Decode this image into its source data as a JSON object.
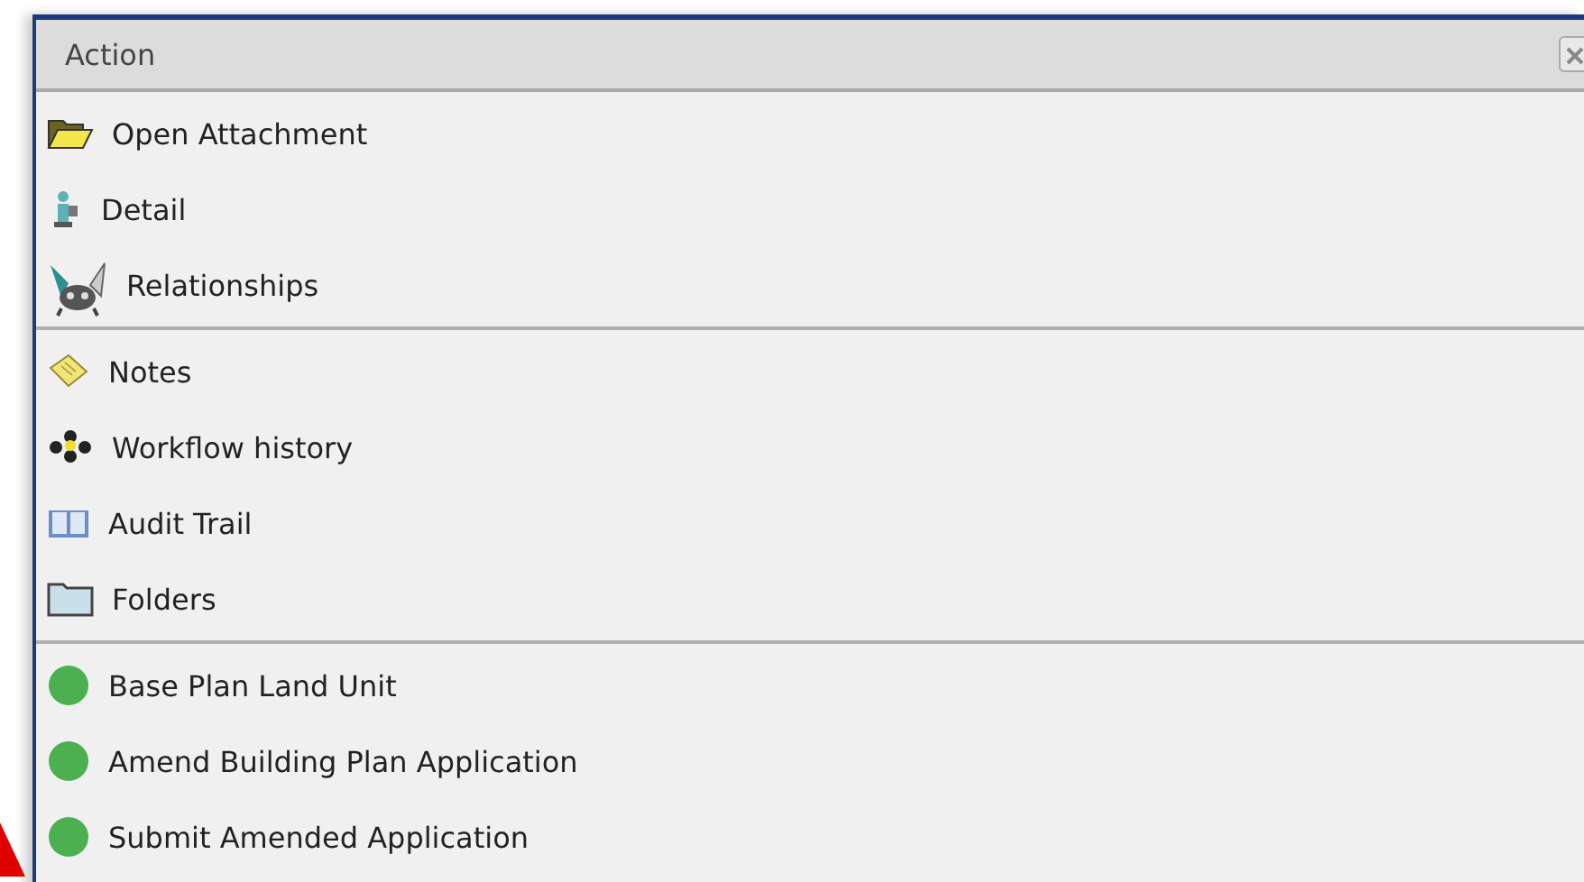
{
  "panel": {
    "title": "Action"
  },
  "groups": [
    [
      {
        "kind": "attachment",
        "label": "Open Attachment"
      },
      {
        "kind": "detail",
        "label": "Detail"
      },
      {
        "kind": "relationships",
        "label": "Relationships"
      }
    ],
    [
      {
        "kind": "notes",
        "label": "Notes"
      },
      {
        "kind": "workflow",
        "label": "Workflow history"
      },
      {
        "kind": "audit",
        "label": "Audit Trail"
      },
      {
        "kind": "folders",
        "label": "Folders"
      }
    ],
    [
      {
        "kind": "task",
        "label": "Base Plan Land Unit",
        "color": "#4caf50"
      },
      {
        "kind": "task",
        "label": "Amend Building Plan Application",
        "color": "#4caf50"
      },
      {
        "kind": "task",
        "label": "Submit Amended Application",
        "color": "#4caf50"
      }
    ]
  ]
}
